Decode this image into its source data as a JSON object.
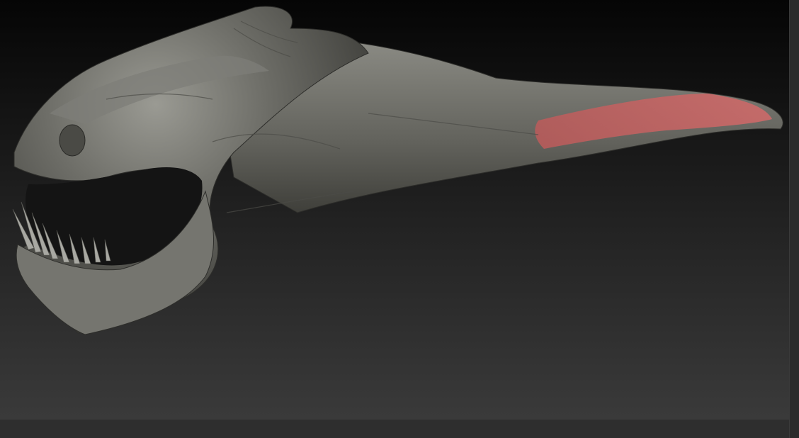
{
  "viewport": {
    "subject_icon": "sculpted-creature-head-model",
    "background_top": "#050505",
    "background_bottom": "#3a3a3a",
    "model_color": "#6b6b66",
    "mask_color": "#d96a6a"
  },
  "scrollbar": {
    "color": "#2b2b2b"
  },
  "status_strip": {
    "color": "#2e2e2e"
  }
}
